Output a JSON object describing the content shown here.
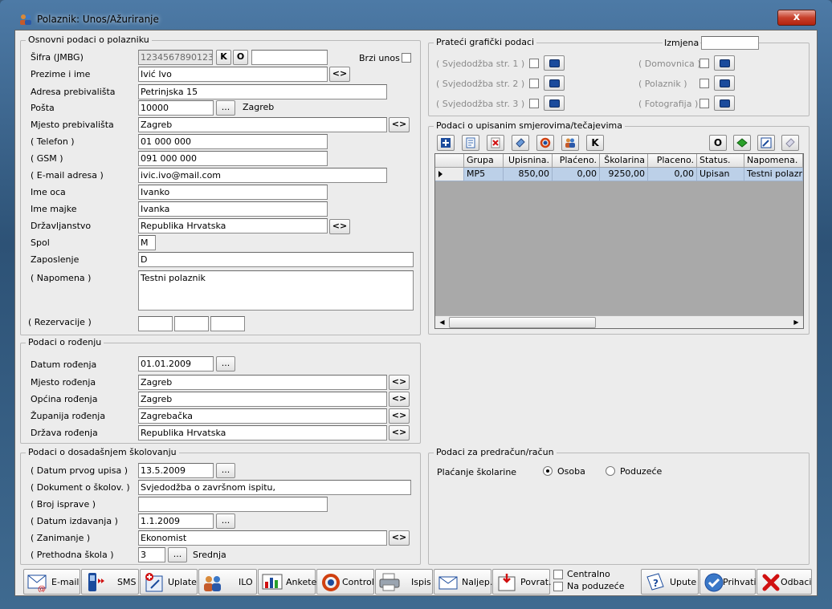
{
  "window": {
    "title": "Polaznik: Unos/Ažuriranje",
    "close": "x"
  },
  "osnovni": {
    "title": "Osnovni podaci o polazniku",
    "sifra_label": "Šifra (JMBG)",
    "sifra": "1234567890123",
    "k": "K",
    "o": "O",
    "sifra2": "",
    "brzi_unos": "Brzi unos",
    "prezime_label": "Prezime i ime",
    "prezime": "Ivić Ivo",
    "adresa_label": "Adresa prebivališta",
    "adresa": "Petrinjska 15",
    "posta_label": "Pošta",
    "posta": "10000",
    "posta_grad": "Zagreb",
    "mjesto_label": "Mjesto prebivališta",
    "mjesto": "Zagreb",
    "telefon_label": "( Telefon )",
    "telefon": "01 000 000",
    "gsm_label": "( GSM )",
    "gsm": "091 000 000",
    "email_label": "( E-mail adresa )",
    "email": "ivic.ivo@mail.com",
    "otac_label": "Ime oca",
    "otac": "Ivanko",
    "majka_label": "Ime majke",
    "majka": "Ivanka",
    "drz_label": "Državljanstvo",
    "drz": "Republika Hrvatska",
    "spol_label": "Spol",
    "spol": "M",
    "zap_label": "Zaposlenje",
    "zap": "D",
    "nap_label": "( Napomena )",
    "nap": "Testni polaznik",
    "rez_label": "( Rezervacije )"
  },
  "arrow": "<>",
  "dots": "...",
  "rodjenje": {
    "title": "Podaci o rođenju",
    "datum_label": "Datum rođenja",
    "datum": "01.01.2009",
    "mjesto_label": "Mjesto rođenja",
    "mjesto": "Zagreb",
    "opcina_label": "Općina rođenja",
    "opcina": "Zagreb",
    "zup_label": "Županija rođenja",
    "zup": "Zagrebačka",
    "drz_label": "Država rođenja",
    "drz": "Republika Hrvatska"
  },
  "skolovanje": {
    "title": "Podaci o dosadašnjem školovanju",
    "upis_label": "( Datum prvog upisa )",
    "upis": "13.5.2009",
    "dok_label": "( Dokument o školov. )",
    "dok": "Svjedodžba o završnom ispitu,",
    "broj_label": "( Broj isprave )",
    "broj": "",
    "izd_label": "( Datum izdavanja )",
    "izd": "1.1.2009",
    "zan_label": "( Zanimanje )",
    "zan": "Ekonomist",
    "preth_label": "( Prethodna škola )",
    "preth": "3",
    "preth_naziv": "Srednja"
  },
  "graficki": {
    "title": "Prateći grafički podaci",
    "izmjena": "Izmjena",
    "items": [
      "( Svjedodžba str. 1 )",
      "( Svjedodžba str. 2 )",
      "( Svjedodžba str. 3 )",
      "( Domovnica )",
      "( Polaznik )",
      "( Fotografija )"
    ]
  },
  "upisi": {
    "title": "Podaci o upisanim smjerovima/tečajevima",
    "k": "K",
    "o": "O",
    "columns": [
      "Grupa",
      "Upisnina.",
      "Plaćeno.",
      "Školarina",
      "Placeno.",
      "Status.",
      "Napomena."
    ],
    "row": [
      "MP5",
      "850,00",
      "0,00",
      "9250,00",
      "0,00",
      "Upisan",
      "Testni polazni"
    ]
  },
  "racun": {
    "title": "Podaci za predračun/račun",
    "placanje": "Plaćanje školarine",
    "osoba": "Osoba",
    "poduzece": "Poduzeće"
  },
  "bottom": {
    "email": "E-mail",
    "sms": "SMS",
    "uplate": "Uplate",
    "ilo": "ILO",
    "ankete": "Ankete",
    "control": "Control",
    "ispis": "Ispis",
    "naljep": "Naljep.",
    "povrat": "Povrat.",
    "centralno": "Centralno",
    "napoduzece": "Na poduzeće",
    "upute": "Upute",
    "prihvati": "Prihvati",
    "odbaci": "Odbaci"
  },
  "colors": {
    "accent": "#1b4b9c",
    "selected_row": "#bcd0e8",
    "grid_bg": "#a9a9a9"
  }
}
